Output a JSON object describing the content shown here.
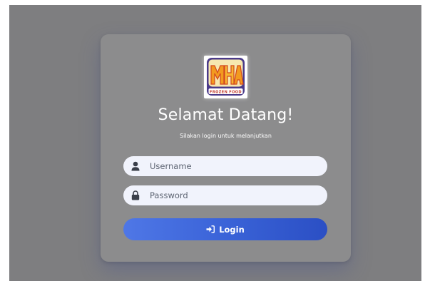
{
  "login": {
    "welcome_title": "Selamat Datang!",
    "subtitle": "Silakan login untuk melanjutkan",
    "username": {
      "placeholder": "Username",
      "value": "",
      "icon": "user-icon"
    },
    "password": {
      "placeholder": "Password",
      "value": "",
      "icon": "lock-icon"
    },
    "login_button": {
      "label": "Login",
      "icon": "sign-in-icon"
    }
  },
  "logo": {
    "tagline": "FROZEN FOOD"
  },
  "colors": {
    "backdrop": "#7e7e80",
    "card": "#8c8c8d",
    "input_bg": "#f1f3fc",
    "button_start": "#4f77e6",
    "button_end": "#2b4fc4",
    "text_on_card": "#ffffff"
  }
}
